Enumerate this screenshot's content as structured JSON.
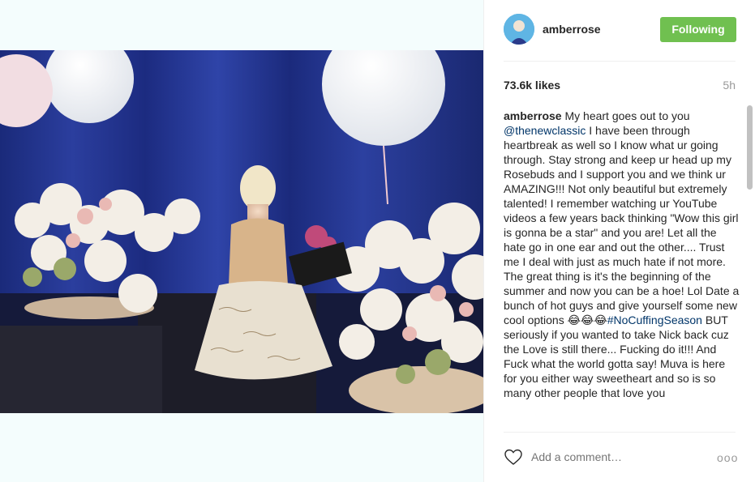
{
  "post": {
    "username": "amberrose",
    "follow_label": "Following",
    "likes": "73.6k likes",
    "time": "5h"
  },
  "caption": {
    "author": "amberrose",
    "part1": " My heart goes out to you ",
    "mention": "@thenewclassic",
    "part2": " I have been through heartbreak as well so I know what ur going through. Stay strong and keep ur head up my Rosebuds and I support you and we think ur AMAZING!!! Not only beautiful but extremely talented! I remember watching ur YouTube videos a few years back thinking \"Wow this girl is gonna be a star\" and you are! Let all the hate go in one ear and out the other.... Trust me I deal with just as much hate if not more. The great thing is it's the beginning of the summer and now you can be a hoe! Lol Date a bunch of hot guys and give yourself some new cool options 😂😂😂",
    "hashtag": "#NoCuffingSeason",
    "part3": " BUT seriously if you wanted to take Nick back cuz the Love is still there... Fucking do it!!! And Fuck what the world gotta say! Muva is here for you either way sweetheart and so is so many other people that love you"
  },
  "footer": {
    "comment_placeholder": "Add a comment…",
    "more_label": "ooo"
  },
  "icons": {
    "like": "heart-outline-icon",
    "more": "more-options-icon"
  },
  "colors": {
    "follow_button": "#70c050",
    "link": "#003569",
    "muted": "#999999"
  }
}
